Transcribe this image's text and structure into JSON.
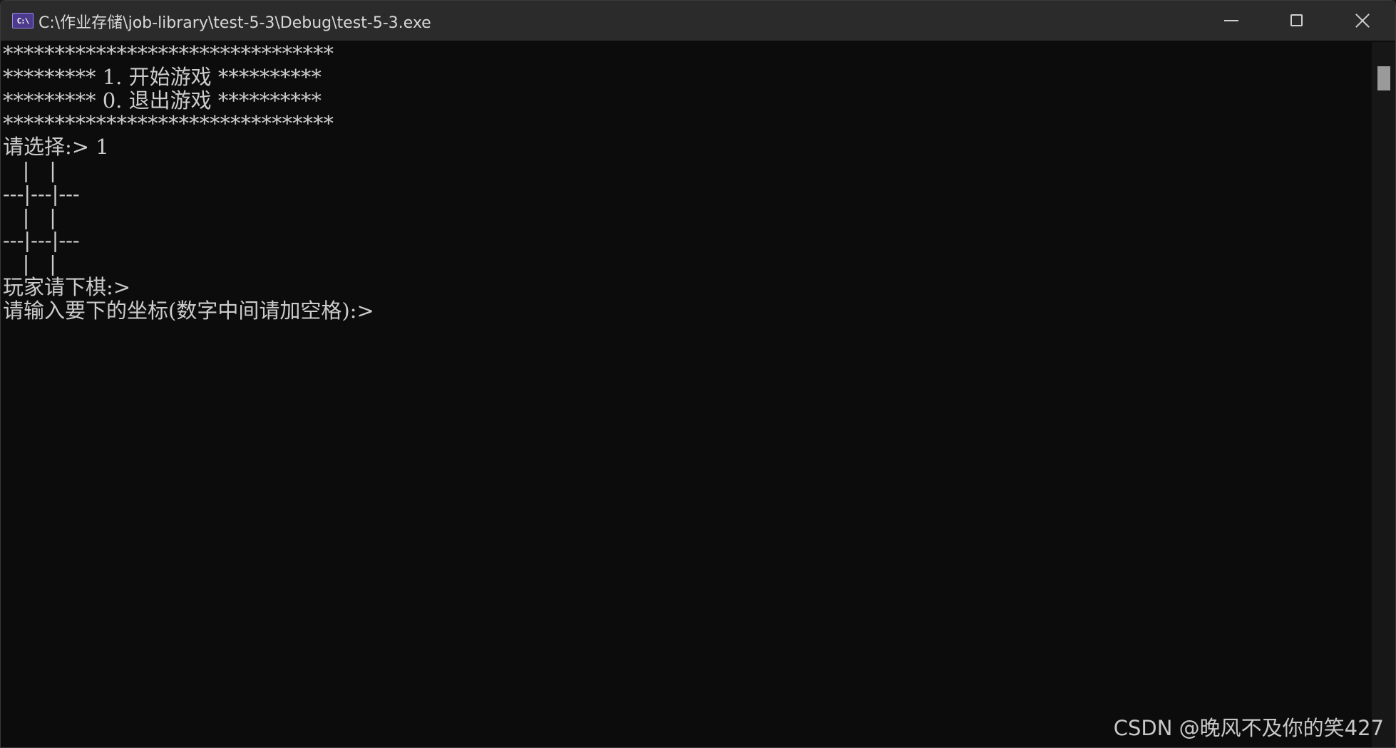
{
  "window": {
    "title": "C:\\作业存储\\job-library\\test-5-3\\Debug\\test-5-3.exe",
    "icon_label": "C:\\",
    "icon": "console-app-icon",
    "controls": {
      "minimize_icon": "minimize-icon",
      "maximize_icon": "maximize-icon",
      "close_icon": "close-icon"
    }
  },
  "console": {
    "lines": [
      "********************************",
      "********* 1. 开始游戏 **********",
      "********* 0. 退出游戏 **********",
      "********************************",
      "请选择:> 1",
      "   |   |",
      "---|---|---",
      "   |   |",
      "---|---|---",
      "   |   |",
      "玩家请下棋:>",
      "请输入要下的坐标(数字中间请加空格):>"
    ],
    "colors": {
      "background": "#0c0c0c",
      "foreground": "#cccccc"
    }
  },
  "watermark": "CSDN @晚风不及你的笑427"
}
